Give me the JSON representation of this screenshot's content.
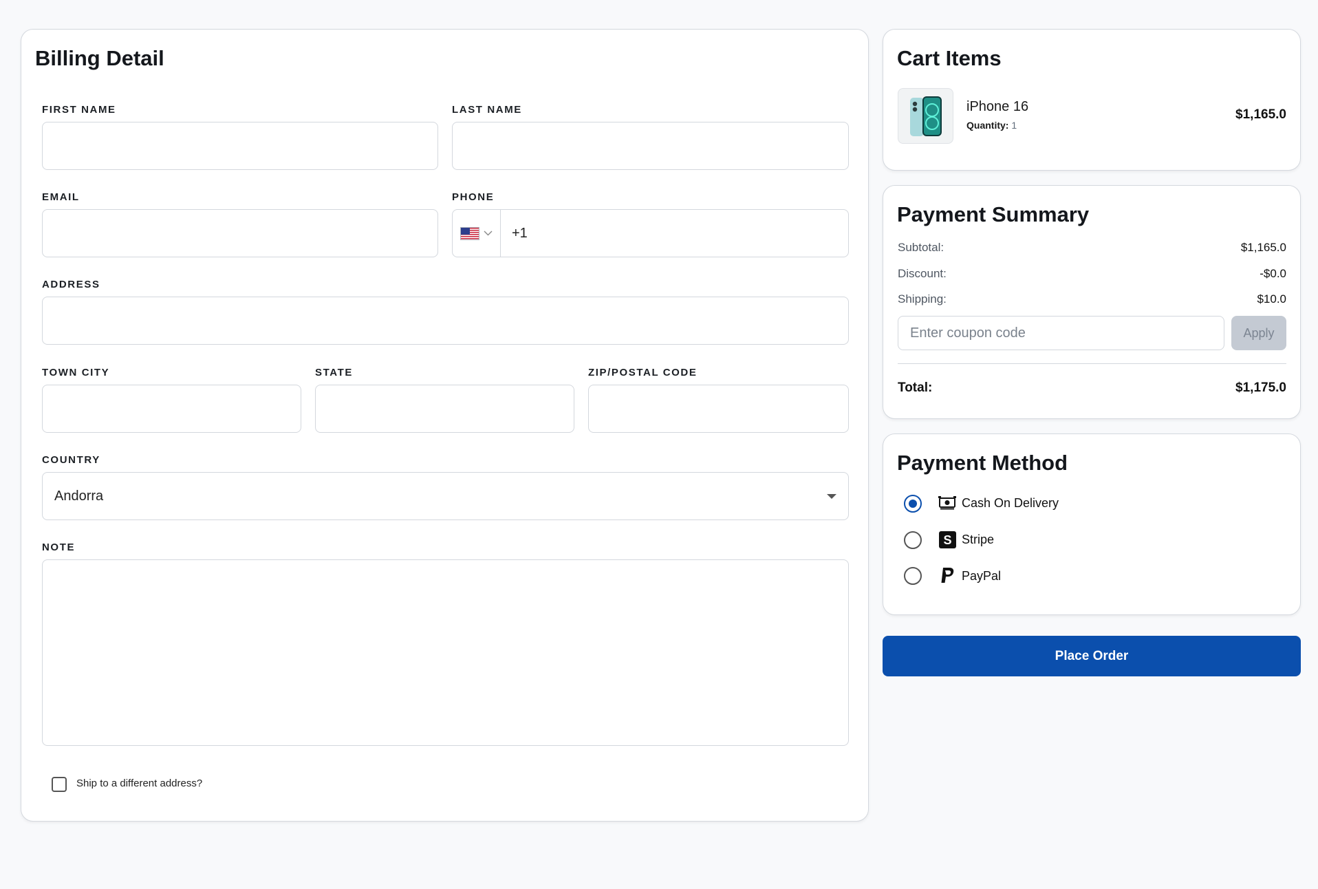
{
  "billing": {
    "title": "Billing Detail",
    "first_name": {
      "label": "FIRST NAME",
      "value": ""
    },
    "last_name": {
      "label": "LAST NAME",
      "value": ""
    },
    "email": {
      "label": "EMAIL",
      "value": ""
    },
    "phone": {
      "label": "PHONE",
      "value": "+1",
      "country_flag": "us-flag-icon"
    },
    "address": {
      "label": "ADDRESS",
      "value": ""
    },
    "town_city": {
      "label": "TOWN CITY",
      "value": ""
    },
    "state": {
      "label": "STATE",
      "value": ""
    },
    "zip": {
      "label": "ZIP/POSTAL CODE",
      "value": ""
    },
    "country": {
      "label": "COUNTRY",
      "value": "Andorra"
    },
    "note": {
      "label": "NOTE",
      "value": ""
    },
    "ship_different": {
      "label": "Ship to a different address?",
      "checked": false
    }
  },
  "cart": {
    "title": "Cart Items",
    "items": [
      {
        "name": "iPhone 16",
        "quantity_label": "Quantity:",
        "quantity": "1",
        "price": "$1,165.0",
        "image_icon": "iphone-image"
      }
    ]
  },
  "summary": {
    "title": "Payment Summary",
    "subtotal_label": "Subtotal:",
    "subtotal": "$1,165.0",
    "discount_label": "Discount:",
    "discount": "-$0.0",
    "shipping_label": "Shipping:",
    "shipping": "$10.0",
    "coupon_placeholder": "Enter coupon code",
    "apply_label": "Apply",
    "total_label": "Total:",
    "total": "$1,175.0"
  },
  "payment_method": {
    "title": "Payment Method",
    "options": [
      {
        "label": "Cash On Delivery",
        "icon": "cash-icon",
        "selected": true
      },
      {
        "label": "Stripe",
        "icon": "stripe-icon",
        "selected": false
      },
      {
        "label": "PayPal",
        "icon": "paypal-icon",
        "selected": false
      }
    ]
  },
  "place_order_label": "Place Order",
  "colors": {
    "primary": "#0b4fad",
    "apply_disabled": "#c4cad3"
  }
}
